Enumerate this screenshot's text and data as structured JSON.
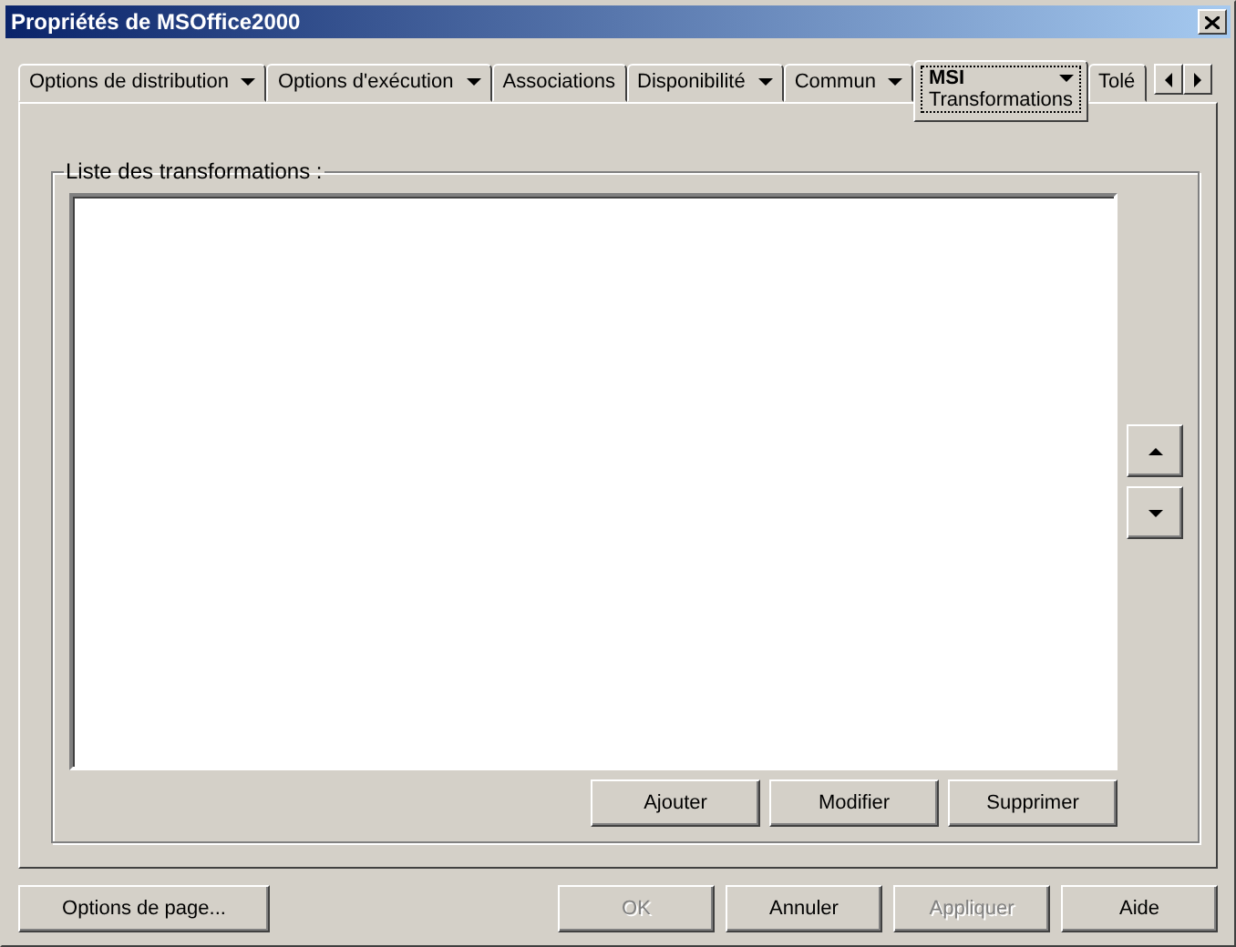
{
  "window": {
    "title": "Propriétés de MSOffice2000"
  },
  "tabs": [
    {
      "label": "Options de distribution",
      "dropdown": true,
      "selected": false
    },
    {
      "label": "Options d'exécution",
      "dropdown": true,
      "selected": false
    },
    {
      "label": "Associations",
      "dropdown": false,
      "selected": false
    },
    {
      "label": "Disponibilité",
      "dropdown": true,
      "selected": false
    },
    {
      "label": "Commun",
      "dropdown": true,
      "selected": false
    },
    {
      "label": "MSI",
      "dropdown": true,
      "selected": true,
      "subtab": "Transformations"
    },
    {
      "label": "Tolé",
      "dropdown": false,
      "selected": false
    }
  ],
  "group": {
    "label": "Liste des transformations :",
    "list_buttons": [
      {
        "label": "Ajouter",
        "disabled": false
      },
      {
        "label": "Modifier",
        "disabled": false
      },
      {
        "label": "Supprimer",
        "disabled": false
      }
    ]
  },
  "footer": {
    "left_button": {
      "label": "Options de page...",
      "disabled": false
    },
    "buttons": [
      {
        "label": "OK",
        "disabled": true
      },
      {
        "label": "Annuler",
        "disabled": false
      },
      {
        "label": "Appliquer",
        "disabled": true
      },
      {
        "label": "Aide",
        "disabled": false
      }
    ]
  }
}
